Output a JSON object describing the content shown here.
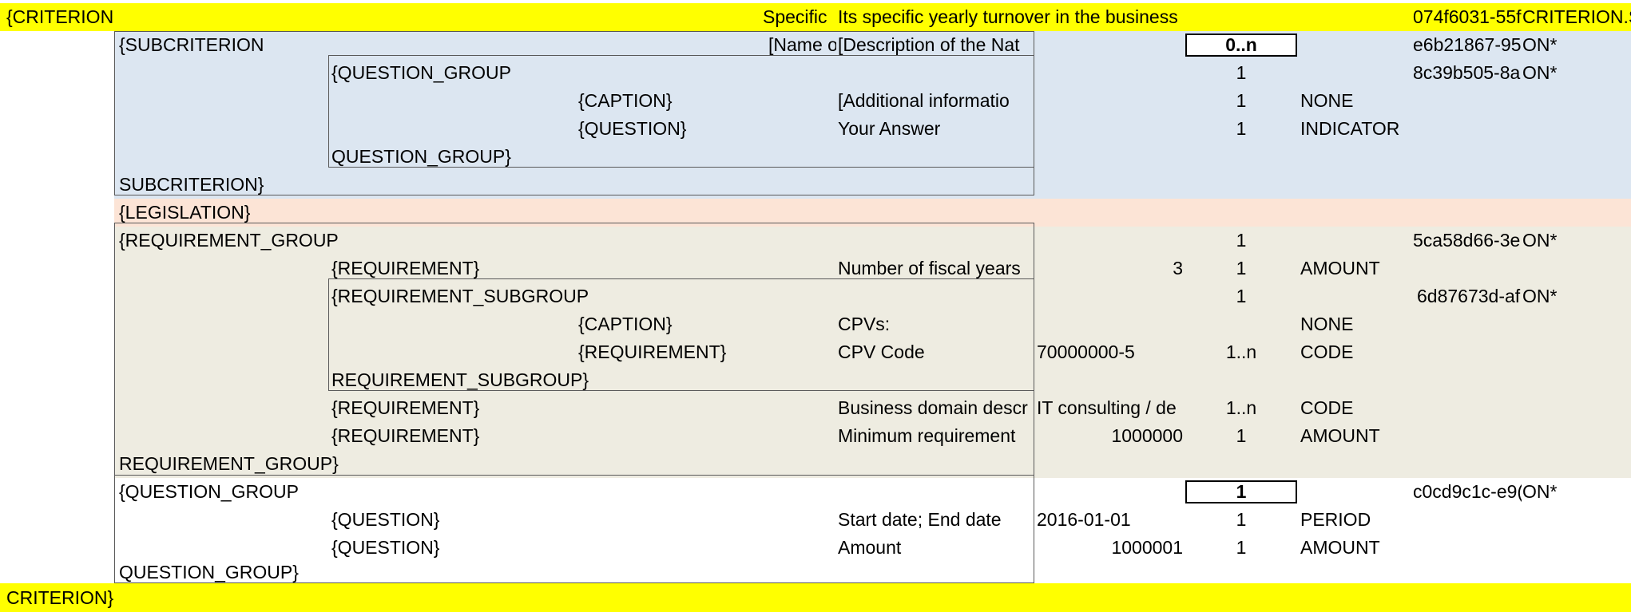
{
  "criterion": {
    "open": "{CRITERION",
    "col_g": "Specific",
    "col_h": "Its specific yearly turnover in the business",
    "id": "074f6031-55f",
    "type": "CRITERION.S",
    "close": "CRITERION}"
  },
  "subcriterion": {
    "open": "{SUBCRITERION",
    "name": "[Name o",
    "description": "[Description of the Nat",
    "cardinality": "0..n",
    "id": "e6b21867-95",
    "suffix": "ON*",
    "close": "SUBCRITERION}",
    "question_group": {
      "open": "{QUESTION_GROUP",
      "cardinality": "1",
      "id": "8c39b505-8a",
      "suffix": "ON*",
      "close": "QUESTION_GROUP}",
      "caption": {
        "tag": "{CAPTION}",
        "text": "[Additional informatio",
        "cardinality": "1",
        "type": "NONE"
      },
      "question": {
        "tag": "{QUESTION}",
        "text": "Your Answer",
        "cardinality": "1",
        "type": "INDICATOR"
      }
    }
  },
  "legislation": {
    "label": "{LEGISLATION}"
  },
  "requirement_group": {
    "open": "{REQUIREMENT_GROUP",
    "cardinality": "1",
    "id": "5ca58d66-3e",
    "suffix": "ON*",
    "close": "REQUIREMENT_GROUP}",
    "req1": {
      "tag": "{REQUIREMENT}",
      "text": "Number of fiscal years",
      "value": "3",
      "cardinality": "1",
      "type": "AMOUNT"
    },
    "subgroup": {
      "open": "{REQUIREMENT_SUBGROUP",
      "cardinality": "1",
      "id": "6d87673d-af",
      "suffix": "ON*",
      "close": "REQUIREMENT_SUBGROUP}",
      "caption": {
        "tag": "{CAPTION}",
        "text": "CPVs:",
        "type": "NONE"
      },
      "req": {
        "tag": "{REQUIREMENT}",
        "text": "CPV Code",
        "value": "70000000-5",
        "cardinality": "1..n",
        "type": "CODE"
      }
    },
    "req2": {
      "tag": "{REQUIREMENT}",
      "text": "Business domain descr",
      "value": "IT consulting / de",
      "cardinality": "1..n",
      "type": "CODE"
    },
    "req3": {
      "tag": "{REQUIREMENT}",
      "text": "Minimum requirement",
      "value": "1000000",
      "cardinality": "1",
      "type": "AMOUNT"
    }
  },
  "question_group": {
    "open": "{QUESTION_GROUP",
    "cardinality": "1",
    "id": "c0cd9c1c-e9(",
    "suffix": "ON*",
    "close": "QUESTION_GROUP}",
    "q1": {
      "tag": "{QUESTION}",
      "text": "Start date; End date",
      "value": "2016-01-01",
      "cardinality": "1",
      "type": "PERIOD"
    },
    "q2": {
      "tag": "{QUESTION}",
      "text": "Amount",
      "value": "1000001",
      "cardinality": "1",
      "type": "AMOUNT"
    }
  }
}
